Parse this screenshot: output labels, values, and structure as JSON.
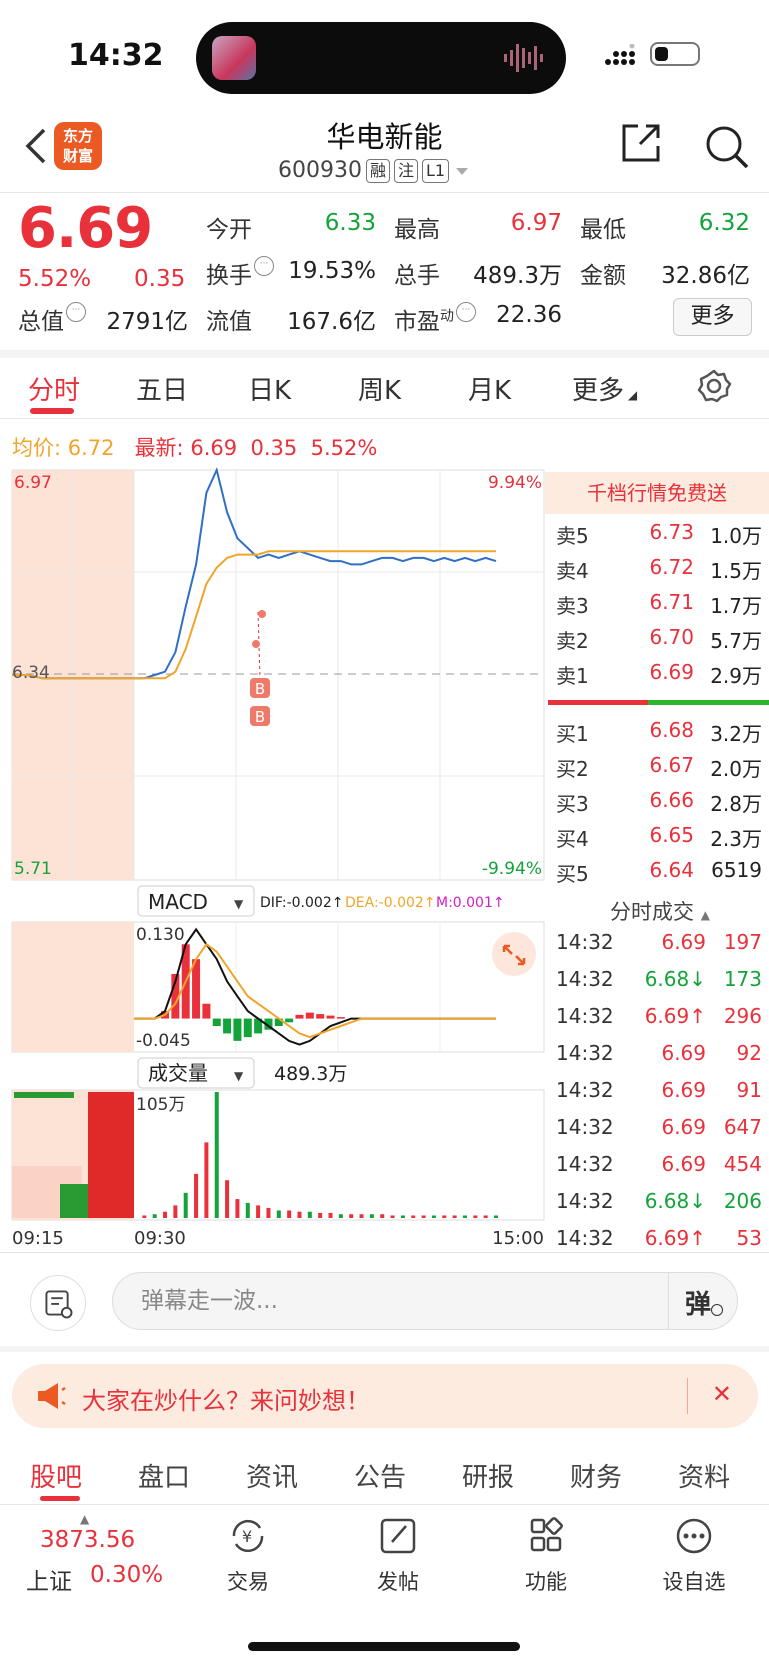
{
  "status_bar": {
    "time": "14:32"
  },
  "header": {
    "logo_line1": "东方",
    "logo_line2": "财富",
    "stock_name": "华电新能",
    "stock_code": "600930",
    "tags": [
      "融",
      "注",
      "L1"
    ]
  },
  "quote": {
    "price": "6.69",
    "change_pct": "5.52%",
    "change": "0.35",
    "open_label": "今开",
    "open": "6.33",
    "high_label": "最高",
    "high": "6.97",
    "low_label": "最低",
    "low": "6.32",
    "turnover_label": "换手",
    "turnover": "19.53%",
    "volume_label": "总手",
    "volume": "489.3万",
    "amount_label": "金额",
    "amount": "32.86亿",
    "mktcap_label": "总值",
    "mktcap": "2791亿",
    "float_label": "流值",
    "float_cap": "167.6亿",
    "pe_label": "市盈",
    "pe_sup": "动",
    "pe": "22.36",
    "more_label": "更多"
  },
  "period_tabs": [
    "分时",
    "五日",
    "日K",
    "周K",
    "月K",
    "更多"
  ],
  "chart_header": {
    "avg_label": "均价:",
    "avg": "6.72",
    "latest_label": "最新:",
    "latest": "6.69",
    "latest_change": "0.35",
    "latest_pct": "5.52%"
  },
  "chart_data": [
    {
      "type": "line",
      "name": "intraday",
      "y_top": "6.97",
      "y_mid": "6.34",
      "y_bottom": "5.71",
      "pct_top": "9.94%",
      "pct_bottom": "-9.94%",
      "ylim": [
        5.71,
        6.97
      ],
      "prev_close": 6.34,
      "series": [
        {
          "values": [
            6.34,
            6.34,
            6.33,
            6.33,
            6.33,
            6.33,
            6.33,
            6.33,
            6.33,
            6.33,
            6.34,
            6.35,
            6.41,
            6.55,
            6.68,
            6.9,
            6.97,
            6.84,
            6.76,
            6.73,
            6.7,
            6.71,
            6.7,
            6.71,
            6.72,
            6.71,
            6.7,
            6.69,
            6.69,
            6.68,
            6.68,
            6.69,
            6.7,
            6.7,
            6.69,
            6.7,
            6.7,
            6.69,
            6.7,
            6.69,
            6.7,
            6.69,
            6.7,
            6.69
          ]
        },
        {
          "values": [
            6.34,
            6.34,
            6.33,
            6.33,
            6.33,
            6.33,
            6.33,
            6.33,
            6.33,
            6.33,
            6.33,
            6.33,
            6.35,
            6.42,
            6.52,
            6.62,
            6.67,
            6.7,
            6.71,
            6.71,
            6.71,
            6.72,
            6.72,
            6.72,
            6.72,
            6.72,
            6.72,
            6.72,
            6.72,
            6.72,
            6.72,
            6.72,
            6.72,
            6.72,
            6.72,
            6.72,
            6.72,
            6.72,
            6.72,
            6.72,
            6.72,
            6.72,
            6.72,
            6.72
          ]
        }
      ],
      "markers": [
        "B",
        "B"
      ]
    },
    {
      "type": "line",
      "name": "MACD",
      "selector": "MACD",
      "dif_label": "DIF:-0.002↑",
      "dea_label": "DEA:-0.002↑",
      "m_label": "M:0.001↑",
      "y_top": "0.130",
      "y_bottom": "-0.045",
      "ylim": [
        -0.045,
        0.13
      ],
      "series": [
        {
          "values": [
            0,
            0,
            0,
            0,
            0,
            0,
            0,
            0,
            0,
            0,
            0,
            0.01,
            0.05,
            0.1,
            0.12,
            0.1,
            0.08,
            0.05,
            0.03,
            0.01,
            0,
            -0.01,
            -0.02,
            -0.03,
            -0.035,
            -0.03,
            -0.02,
            -0.01,
            -0.005,
            0,
            0,
            0,
            0,
            0,
            0,
            0,
            0,
            0,
            0,
            0,
            0,
            0,
            0,
            0
          ]
        },
        {
          "values": [
            0,
            0,
            0,
            0,
            0,
            0,
            0,
            0,
            0,
            0,
            0,
            0.005,
            0.02,
            0.05,
            0.08,
            0.1,
            0.09,
            0.07,
            0.05,
            0.03,
            0.02,
            0.01,
            0,
            -0.01,
            -0.02,
            -0.025,
            -0.02,
            -0.015,
            -0.01,
            -0.005,
            0,
            0,
            0,
            0,
            0,
            0,
            0,
            0,
            0,
            0,
            0,
            0,
            0,
            0
          ]
        }
      ],
      "bars": [
        0,
        0,
        0,
        0,
        0,
        0,
        0,
        0,
        0,
        0,
        0,
        0.01,
        0.06,
        0.1,
        0.08,
        0.02,
        -0.01,
        -0.02,
        -0.03,
        -0.025,
        -0.02,
        -0.015,
        -0.01,
        -0.005,
        0.005,
        0.008,
        0.006,
        0.004,
        0.002,
        0,
        0,
        0,
        0,
        0,
        0,
        0,
        0,
        0,
        0,
        0,
        0,
        0,
        0,
        0
      ]
    },
    {
      "type": "bar",
      "name": "volume",
      "selector": "成交量",
      "total": "489.3万",
      "y_top": "105万",
      "x_labels": [
        "09:15",
        "09:30",
        "15:00"
      ],
      "values": [
        0.02,
        0.02,
        0.01,
        0.01,
        0.01,
        0.01,
        0.01,
        0.01,
        0.02,
        0.02,
        0.03,
        0.05,
        0.1,
        0.2,
        0.35,
        0.6,
        1.0,
        0.3,
        0.15,
        0.12,
        0.1,
        0.08,
        0.06,
        0.06,
        0.05,
        0.05,
        0.04,
        0.04,
        0.03,
        0.03,
        0.03,
        0.03,
        0.03,
        0.02,
        0.02,
        0.02,
        0.02,
        0.02,
        0.02,
        0.02,
        0.02,
        0.02,
        0.02,
        0.02
      ]
    }
  ],
  "order_book": {
    "promo": "千档行情免费送",
    "asks": [
      {
        "label": "卖5",
        "price": "6.73",
        "vol": "1.0万"
      },
      {
        "label": "卖4",
        "price": "6.72",
        "vol": "1.5万"
      },
      {
        "label": "卖3",
        "price": "6.71",
        "vol": "1.7万"
      },
      {
        "label": "卖2",
        "price": "6.70",
        "vol": "5.7万"
      },
      {
        "label": "卖1",
        "price": "6.69",
        "vol": "2.9万"
      }
    ],
    "bids": [
      {
        "label": "买1",
        "price": "6.68",
        "vol": "3.2万"
      },
      {
        "label": "买2",
        "price": "6.67",
        "vol": "2.0万"
      },
      {
        "label": "买3",
        "price": "6.66",
        "vol": "2.8万"
      },
      {
        "label": "买4",
        "price": "6.65",
        "vol": "2.3万"
      },
      {
        "label": "买5",
        "price": "6.64",
        "vol": "6519"
      }
    ]
  },
  "trades": {
    "title": "分时成交",
    "rows": [
      {
        "time": "14:32",
        "price": "6.69",
        "vol": "197",
        "color": "#e8313b",
        "vcolor": "#e8313b"
      },
      {
        "time": "14:32",
        "price": "6.68↓",
        "vol": "173",
        "color": "#13a33a",
        "vcolor": "#13a33a"
      },
      {
        "time": "14:32",
        "price": "6.69↑",
        "vol": "296",
        "color": "#e8313b",
        "vcolor": "#e8313b"
      },
      {
        "time": "14:32",
        "price": "6.69",
        "vol": "92",
        "color": "#e8313b",
        "vcolor": "#e8313b"
      },
      {
        "time": "14:32",
        "price": "6.69",
        "vol": "91",
        "color": "#e8313b",
        "vcolor": "#e8313b"
      },
      {
        "time": "14:32",
        "price": "6.69",
        "vol": "647",
        "color": "#e8313b",
        "vcolor": "#e8313b"
      },
      {
        "time": "14:32",
        "price": "6.69",
        "vol": "454",
        "color": "#e8313b",
        "vcolor": "#e8313b"
      },
      {
        "time": "14:32",
        "price": "6.68↓",
        "vol": "206",
        "color": "#13a33a",
        "vcolor": "#13a33a"
      },
      {
        "time": "14:32",
        "price": "6.69↑",
        "vol": "53",
        "color": "#e8313b",
        "vcolor": "#e8313b"
      }
    ]
  },
  "danmu": {
    "placeholder": "弹幕走一波...",
    "button": "弹"
  },
  "ask_banner": {
    "text": "大家在炒什么？来问妙想！",
    "close": "✕"
  },
  "bottom_tabs": [
    "股吧",
    "盘口",
    "资讯",
    "公告",
    "研报",
    "财务",
    "资料"
  ],
  "index": {
    "value": "3873.56",
    "name": "上证",
    "pct": "0.30%"
  },
  "bottom_nav": [
    "交易",
    "发帖",
    "功能",
    "设自选"
  ],
  "colors": {
    "red": "#e8313b",
    "green": "#13a33a",
    "avg": "#f0a52a",
    "price": "#2f6fc6",
    "accent": "#ec5a24"
  }
}
